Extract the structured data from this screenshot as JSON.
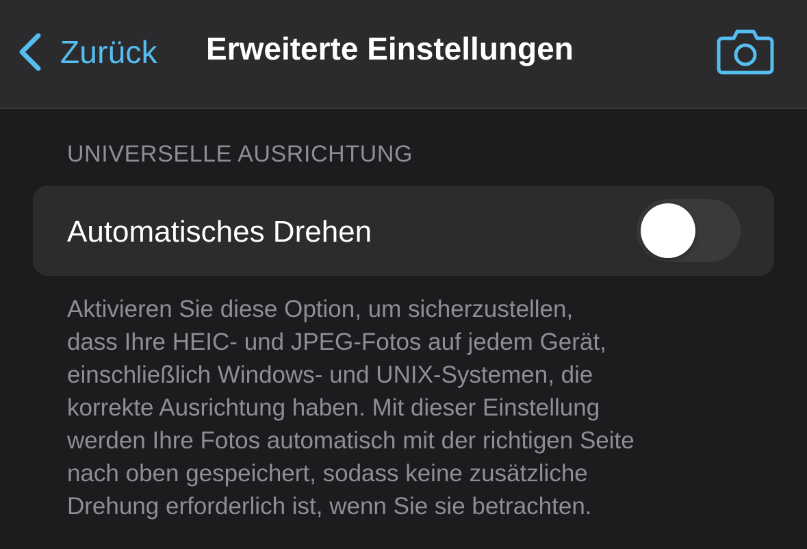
{
  "nav": {
    "back_label": "Zurück",
    "title": "Erweiterte Einstellungen",
    "back_icon": "chevron-left-icon",
    "camera_icon": "camera-icon",
    "accent_color": "#55bef0"
  },
  "section": {
    "header": "UNIVERSELLE AUSRICHTUNG",
    "rows": [
      {
        "label": "Automatisches Drehen",
        "toggle_on": false
      }
    ],
    "footer_lines": [
      "Aktivieren Sie diese Option, um sicherzustellen,",
      "dass Ihre HEIC- und JPEG-Fotos auf jedem Gerät,",
      "einschließlich Windows- und UNIX-Systemen, die",
      "korrekte Ausrichtung haben. Mit dieser Einstellung",
      "werden Ihre Fotos automatisch mit der richtigen Seite",
      "nach oben gespeichert, sodass keine zusätzliche",
      "Drehung erforderlich ist, wenn Sie sie betrachten."
    ]
  },
  "colors": {
    "background": "#1c1c1e",
    "nav_background": "#2b2b2d",
    "card_background": "#2c2c2e",
    "secondary_text": "#8e8e93"
  }
}
